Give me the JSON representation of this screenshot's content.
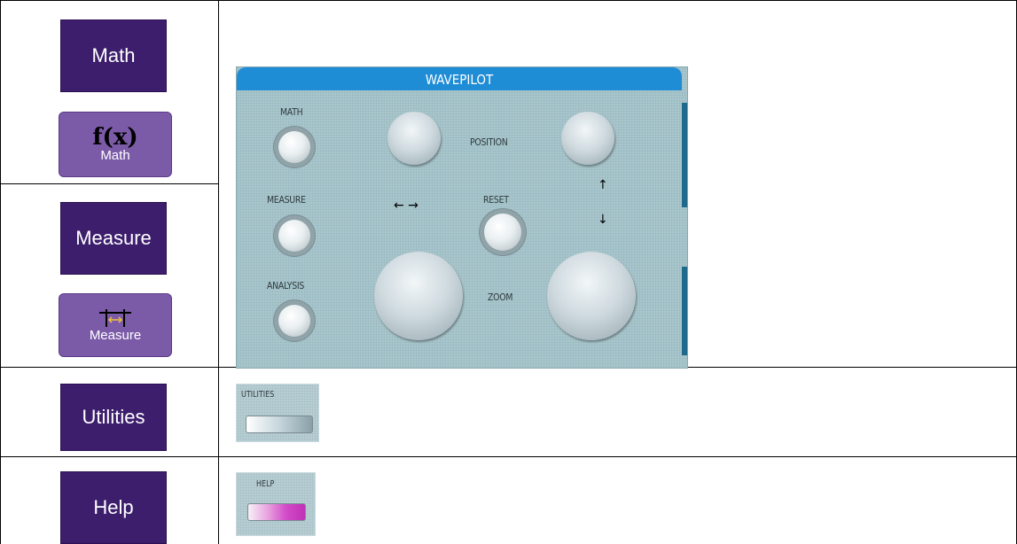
{
  "rows": {
    "math": {
      "button_label": "Math",
      "icon_glyph": "f(x)",
      "icon_label": "Math"
    },
    "measure": {
      "button_label": "Measure",
      "icon_label": "Measure"
    },
    "utilities": {
      "button_label": "Utilities",
      "panel_label": "UTILITIES"
    },
    "help": {
      "button_label": "Help",
      "panel_label": "HELP"
    }
  },
  "wavepilot": {
    "title": "WAVEPILOT",
    "math_label": "MATH",
    "measure_label": "MEASURE",
    "analysis_label": "ANALYSIS",
    "position_label": "POSITION",
    "reset_label": "RESET",
    "zoom_label": "ZOOM",
    "horizontal_arrows": "← →",
    "vertical_arrow_up": "↑",
    "vertical_arrow_down": "↓"
  },
  "colors": {
    "menu_button": "#3d1e6d",
    "icon_button": "#7b5ba8",
    "panel_header": "#1f8dd6",
    "panel_body": "#a8c6cc"
  }
}
